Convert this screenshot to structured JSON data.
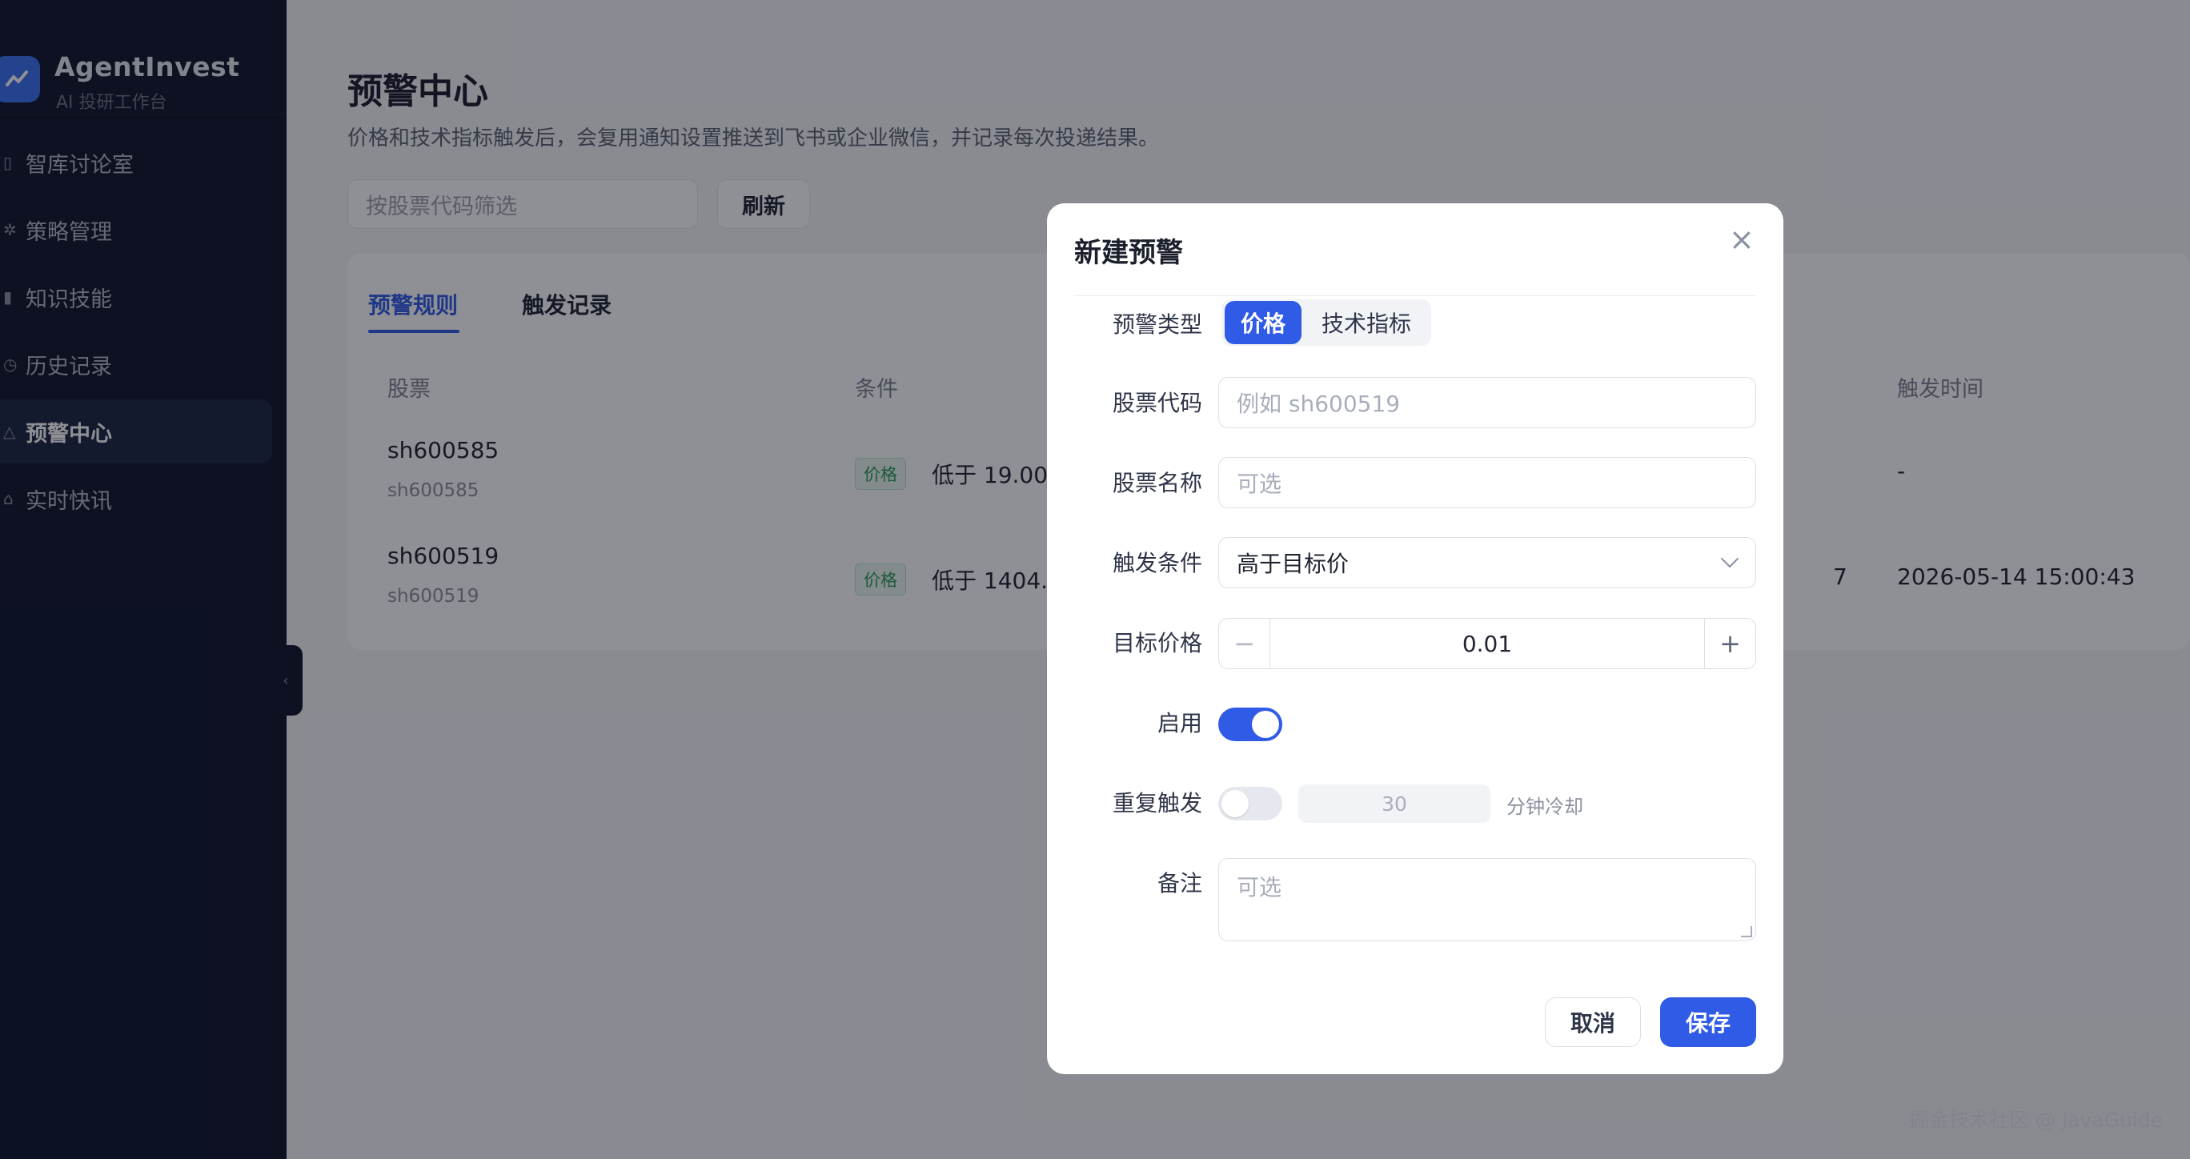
{
  "brand": {
    "name": "AgentInvest",
    "subtitle": "AI 投研工作台"
  },
  "sidebar": {
    "items": [
      {
        "label": "智库讨论室",
        "icon": "chat-icon"
      },
      {
        "label": "策略管理",
        "icon": "gear-icon"
      },
      {
        "label": "知识技能",
        "icon": "book-icon"
      },
      {
        "label": "历史记录",
        "icon": "clock-icon"
      },
      {
        "label": "预警中心",
        "icon": "alert-icon",
        "active": true
      },
      {
        "label": "实时快讯",
        "icon": "bell-icon"
      }
    ]
  },
  "page": {
    "title": "预警中心",
    "description": "价格和技术指标触发后，会复用通知设置推送到飞书或企业微信，并记录每次投递结果。",
    "filter_placeholder": "按股票代码筛选",
    "refresh_label": "刷新"
  },
  "tabs": [
    {
      "label": "预警规则",
      "active": true
    },
    {
      "label": "触发记录",
      "active": false
    }
  ],
  "table": {
    "headers": {
      "stock": "股票",
      "condition": "条件",
      "trigger_time": "触发时间"
    },
    "rows": [
      {
        "name": "sh600585",
        "code": "sh600585",
        "tag": "价格",
        "condition": "低于 19.00",
        "trigger_time": "-"
      },
      {
        "name": "sh600519",
        "code": "sh600519",
        "tag": "价格",
        "condition": "低于 1404.0",
        "partial": "7",
        "trigger_time": "2026-05-14 15:00:43"
      }
    ]
  },
  "modal": {
    "title": "新建预警",
    "type_label": "预警类型",
    "type_options": [
      "价格",
      "技术指标"
    ],
    "type_selected": "价格",
    "code_label": "股票代码",
    "code_placeholder": "例如 sh600519",
    "name_label": "股票名称",
    "name_placeholder": "可选",
    "condition_label": "触发条件",
    "condition_value": "高于目标价",
    "target_label": "目标价格",
    "target_value": "0.01",
    "enable_label": "启用",
    "enabled": true,
    "repeat_label": "重复触发",
    "repeat_enabled": false,
    "cooldown_value": "30",
    "cooldown_unit": "分钟冷却",
    "note_label": "备注",
    "note_placeholder": "可选",
    "cancel_label": "取消",
    "save_label": "保存"
  },
  "watermark": "掘金技术社区 @ JavaGuide",
  "colors": {
    "accent": "#2f5be6",
    "sidebar_bg": "#0f1629",
    "tag_green": "#2e9b54"
  }
}
